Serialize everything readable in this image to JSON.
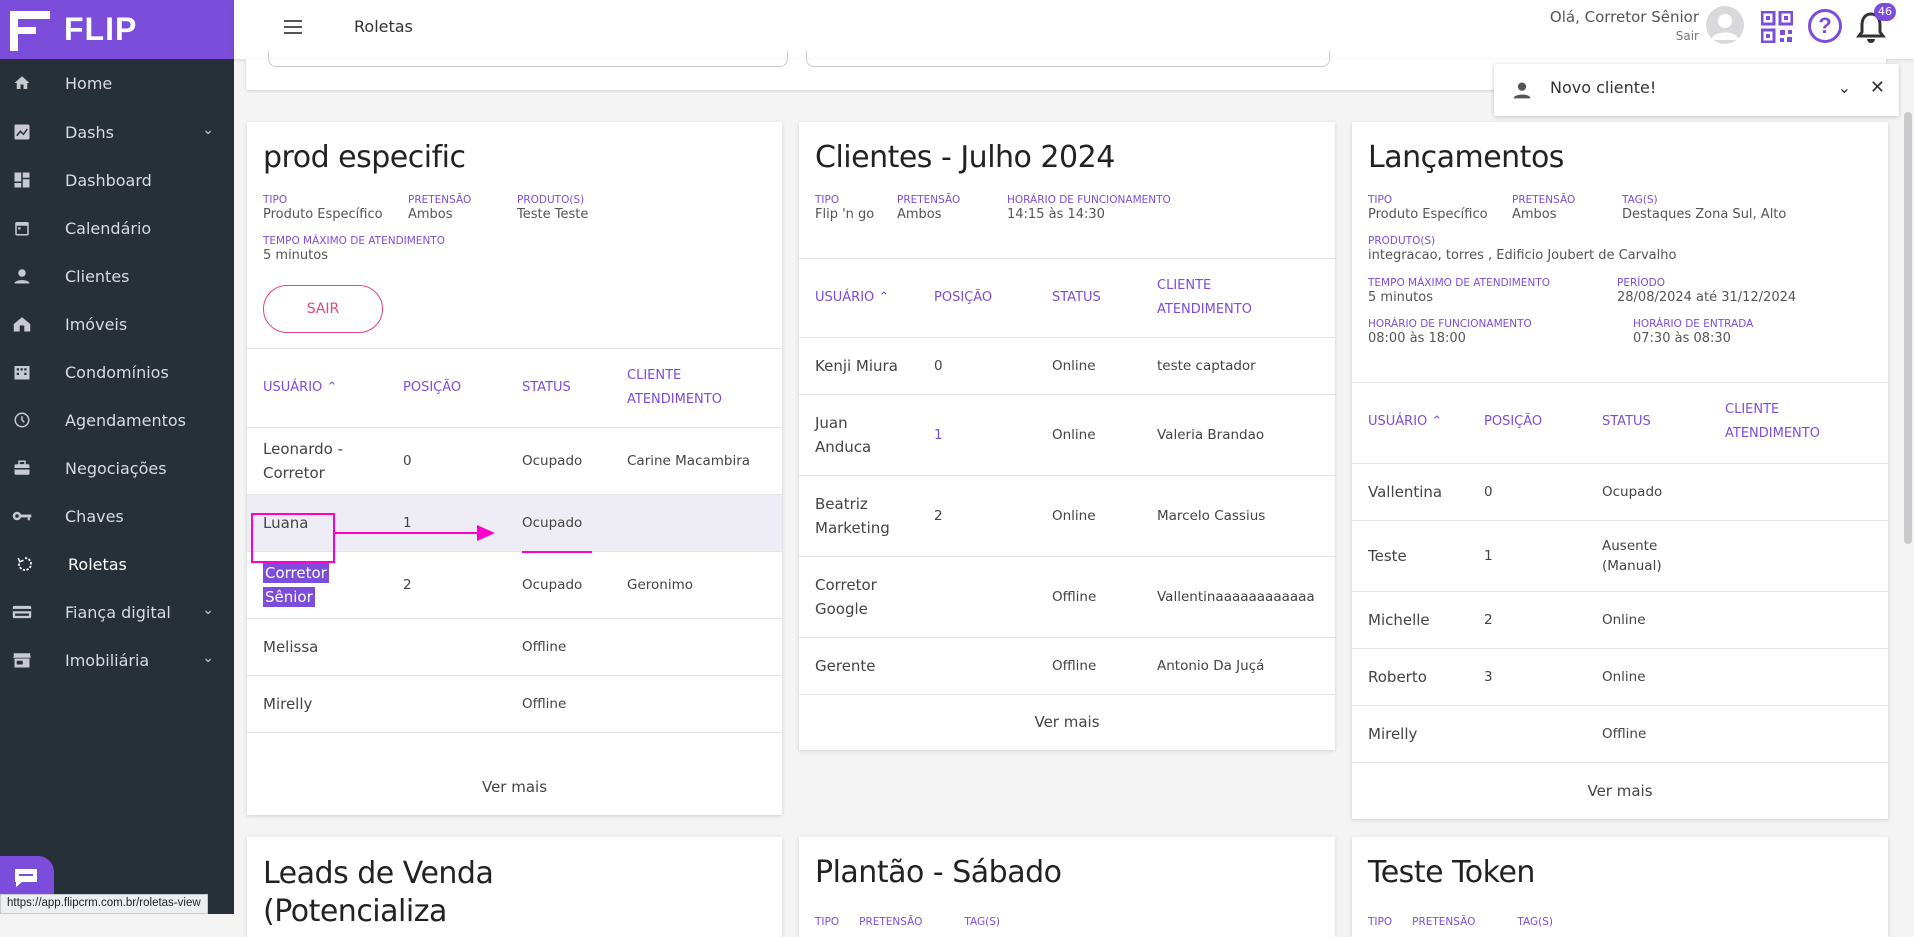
{
  "app": {
    "logo_text": "FLIP",
    "page_title": "Roletas",
    "status_url": "https://app.flipcrm.com.br/roletas-view"
  },
  "colors": {
    "accent": "#7c4dda",
    "sidebar": "#272f38",
    "danger": "#e0457b",
    "annotation": "#ff00cc"
  },
  "sidebar": {
    "items": [
      {
        "label": "Home",
        "icon": "home-icon"
      },
      {
        "label": "Dashs",
        "icon": "chart-icon",
        "expandable": true
      },
      {
        "label": "Dashboard",
        "icon": "dashboard-icon"
      },
      {
        "label": "Calendário",
        "icon": "calendar-icon"
      },
      {
        "label": "Clientes",
        "icon": "person-icon"
      },
      {
        "label": "Imóveis",
        "icon": "house-icon"
      },
      {
        "label": "Condomínios",
        "icon": "building-icon"
      },
      {
        "label": "Agendamentos",
        "icon": "clock-icon"
      },
      {
        "label": "Negociações",
        "icon": "briefcase-icon"
      },
      {
        "label": "Chaves",
        "icon": "key-icon"
      },
      {
        "label": "Roletas",
        "icon": "roulette-icon",
        "active": true
      },
      {
        "label": "Fiança digital",
        "icon": "card-icon",
        "expandable": true
      },
      {
        "label": "Imobiliária",
        "icon": "store-icon",
        "expandable": true
      }
    ]
  },
  "header": {
    "greeting": "Olá, Corretor Sênior",
    "logout": "Sair",
    "notifications_count": "46"
  },
  "toast": {
    "text": "Novo cliente!"
  },
  "cards": {
    "prod": {
      "title": "prod especific",
      "meta": [
        {
          "k": "TIPO",
          "v": "Produto Específico"
        },
        {
          "k": "PRETENSÃO",
          "v": "Ambos"
        },
        {
          "k": "PRODUTO(S)",
          "v": "Teste Teste"
        },
        {
          "k": "TEMPO MÁXIMO DE ATENDIMENTO",
          "v": "5 minutos"
        }
      ],
      "button": "SAIR",
      "headers": [
        "USUÁRIO",
        "POSIÇÃO",
        "STATUS",
        "CLIENTE",
        "ATENDIMENTO"
      ],
      "rows": [
        {
          "user1": "Leonardo -",
          "user2": "Corretor",
          "pos": "0",
          "status": "Ocupado",
          "client": "Carine Macambira"
        },
        {
          "user1": "Luana",
          "user2": "",
          "pos": "1",
          "status": "Ocupado",
          "client": ""
        },
        {
          "user1": "Corretor",
          "user2": "Sênior",
          "pos": "2",
          "status": "Ocupado",
          "client": "Geronimo"
        },
        {
          "user1": "Melissa",
          "user2": "",
          "pos": "",
          "status": "Offline",
          "client": ""
        },
        {
          "user1": "Mirelly",
          "user2": "",
          "pos": "",
          "status": "Offline",
          "client": ""
        }
      ],
      "more": "Ver mais"
    },
    "julho": {
      "title": "Clientes - Julho 2024",
      "meta": [
        {
          "k": "TIPO",
          "v": "Flip 'n go"
        },
        {
          "k": "PRETENSÃO",
          "v": "Ambos"
        },
        {
          "k": "HORÁRIO DE FUNCIONAMENTO",
          "v": "14:15 às 14:30"
        }
      ],
      "headers": [
        "USUÁRIO",
        "POSIÇÃO",
        "STATUS",
        "CLIENTE",
        "ATENDIMENTO"
      ],
      "rows": [
        {
          "user1": "Kenji Miura",
          "user2": "",
          "pos": "0",
          "status": "Online",
          "client": "teste captador"
        },
        {
          "user1": "Juan",
          "user2": "Anduca",
          "pos": "1",
          "status": "Online",
          "client": "Valeria Brandao"
        },
        {
          "user1": "Beatriz",
          "user2": "Marketing",
          "pos": "2",
          "status": "Online",
          "client": "Marcelo Cassius"
        },
        {
          "user1": "Corretor",
          "user2": "Google",
          "pos": "",
          "status": "Offline",
          "client": "Vallentinaaaaaaaaaaaa"
        },
        {
          "user1": "Gerente",
          "user2": "",
          "pos": "",
          "status": "Offline",
          "client": "Antonio Da Juçá"
        }
      ],
      "more": "Ver mais"
    },
    "lanc": {
      "title": "Lançamentos",
      "meta": [
        {
          "k": "TIPO",
          "v": "Produto Específico"
        },
        {
          "k": "PRETENSÃO",
          "v": "Ambos"
        },
        {
          "k": "TAG(S)",
          "v": "Destaques Zona Sul, Alto"
        },
        {
          "k": "PRODUTO(S)",
          "v": "integracao, torres , Edificio Joubert de Carvalho"
        },
        {
          "k": "TEMPO MÁXIMO DE ATENDIMENTO",
          "v": "5 minutos"
        },
        {
          "k": "PERÍODO",
          "v": "28/08/2024 até 31/12/2024"
        },
        {
          "k": "HORÁRIO DE FUNCIONAMENTO",
          "v": "08:00 às 18:00"
        },
        {
          "k": "HORÁRIO DE ENTRADA",
          "v": "07:30 às 08:30"
        }
      ],
      "headers": [
        "USUÁRIO",
        "POSIÇÃO",
        "STATUS",
        "CLIENTE",
        "ATENDIMENTO"
      ],
      "rows": [
        {
          "user1": "Vallentina",
          "pos": "0",
          "status1": "Ocupado",
          "status2": ""
        },
        {
          "user1": "Teste",
          "pos": "1",
          "status1": "Ausente",
          "status2": "(Manual)"
        },
        {
          "user1": "Michelle",
          "pos": "2",
          "status1": "Online",
          "status2": ""
        },
        {
          "user1": "Roberto",
          "pos": "3",
          "status1": "Online",
          "status2": ""
        },
        {
          "user1": "Mirelly",
          "pos": "",
          "status1": "Offline",
          "status2": ""
        }
      ],
      "more": "Ver mais"
    },
    "bottom": [
      {
        "title1": "Leads de Venda",
        "title2": "(Potencializa"
      },
      {
        "title1": "Plantão - Sábado",
        "title2": ""
      },
      {
        "title1": "Teste Token",
        "title2": ""
      }
    ],
    "bottom_meta": [
      "TIPO",
      "PRETENSÃO",
      "TAG(S)"
    ]
  }
}
